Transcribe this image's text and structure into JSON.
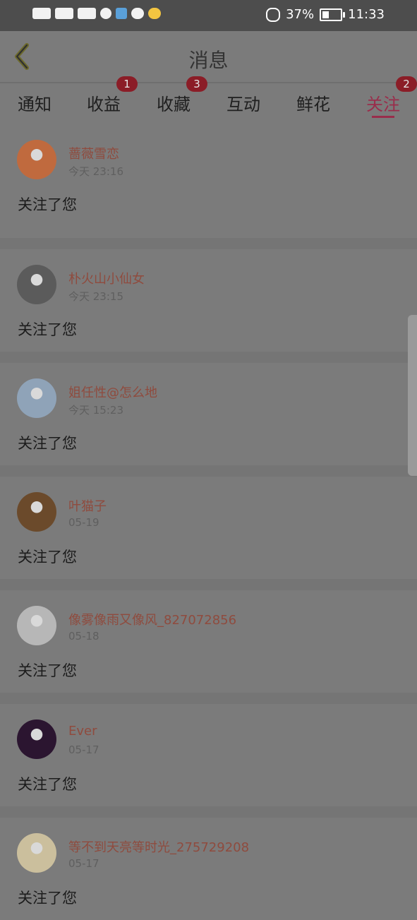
{
  "status_bar": {
    "battery": "37%",
    "time": "11:33",
    "battery_level": 0.37,
    "icons": [
      "hd-icon",
      "signal-4g-icon",
      "signal-4g-icon",
      "hotspot-icon",
      "app-icon",
      "wechat-icon",
      "star-icon",
      "mute-icon",
      "battery-icon"
    ]
  },
  "header": {
    "title": "消息",
    "back_icon": "chevron-left-icon"
  },
  "tabs": [
    {
      "label": "通知",
      "badge": ""
    },
    {
      "label": "收益",
      "badge": "1"
    },
    {
      "label": "收藏",
      "badge": "3"
    },
    {
      "label": "互动",
      "badge": ""
    },
    {
      "label": "鲜花",
      "badge": ""
    },
    {
      "label": "关注",
      "badge": "2",
      "active": true
    }
  ],
  "messages": [
    {
      "name": "蔷薇雪恋",
      "time": "今天 23:16",
      "text": "关注了您",
      "avatar_color": "#c06a3e"
    },
    {
      "name": "朴火山小仙女",
      "time": "今天 23:15",
      "text": "关注了您",
      "avatar_color": "#5b5b5b"
    },
    {
      "name": "姐任性@怎么地",
      "time": "今天 15:23",
      "text": "关注了您",
      "avatar_color": "#8fa3b8"
    },
    {
      "name": "叶猫子",
      "time": "05-19",
      "text": "关注了您",
      "avatar_color": "#6b4a2b"
    },
    {
      "name": "像雾像雨又像风_827072856",
      "time": "05-18",
      "text": "关注了您",
      "avatar_color": "#b7b7b7"
    },
    {
      "name": "Ever",
      "time": "05-17",
      "text": "关注了您",
      "avatar_color": "#2b1530"
    },
    {
      "name": "等不到天亮等时光_275729208",
      "time": "05-17",
      "text": "关注了您",
      "avatar_color": "#cbbf9d"
    }
  ],
  "colors": {
    "accent": "#9a2d4b",
    "badge": "#8b1d27",
    "name_text": "#8f4b3e"
  }
}
